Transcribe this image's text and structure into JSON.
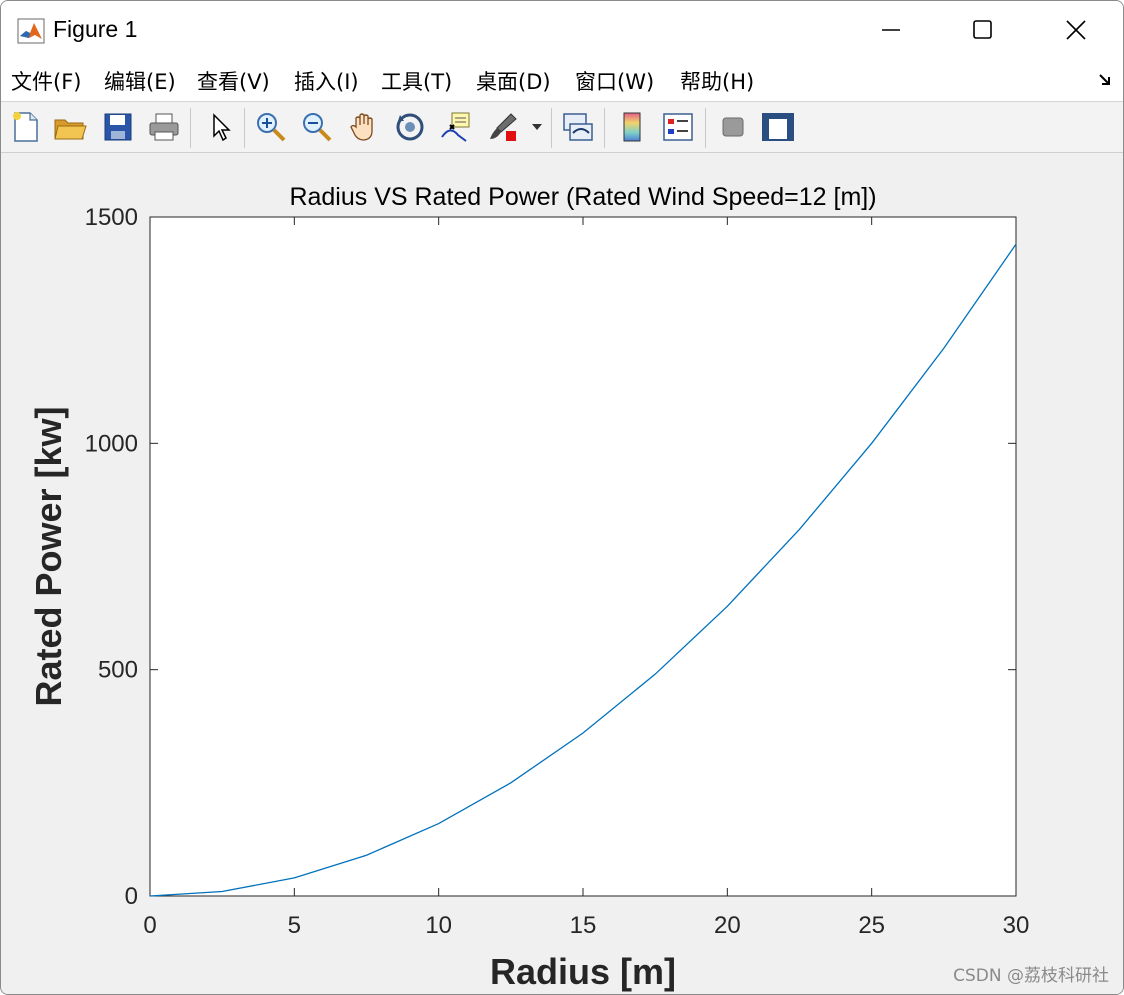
{
  "window": {
    "title": "Figure 1",
    "icons": [
      "matlab-logo-icon",
      "minimize-icon",
      "maximize-icon",
      "close-icon"
    ]
  },
  "menu": {
    "items": [
      "文件(F)",
      "编辑(E)",
      "查看(V)",
      "插入(I)",
      "工具(T)",
      "桌面(D)",
      "窗口(W)",
      "帮助(H)"
    ]
  },
  "toolbar": {
    "tools": [
      "new-figure-icon",
      "open-file-icon",
      "save-icon",
      "print-icon",
      "select-arrow-icon",
      "zoom-in-icon",
      "zoom-out-icon",
      "pan-hand-icon",
      "rotate-3d-icon",
      "data-cursor-icon",
      "brush-icon",
      "brush-dropdown-icon",
      "link-plot-icon",
      "colorbar-icon",
      "legend-icon",
      "hide-plot-tools-icon",
      "show-plot-tools-icon"
    ]
  },
  "chart_data": {
    "type": "line",
    "title": "Radius VS Rated Power (Rated Wind Speed=12 [m])",
    "xlabel": "Radius [m]",
    "ylabel": "Rated Power [kw]",
    "xlim": [
      0,
      30
    ],
    "ylim": [
      0,
      1500
    ],
    "xticks": [
      0,
      5,
      10,
      15,
      20,
      25,
      30
    ],
    "yticks": [
      0,
      500,
      1000,
      1500
    ],
    "grid": false,
    "series": [
      {
        "color": "#0072BD",
        "x": [
          0,
          2.5,
          5,
          7.5,
          10,
          12.5,
          15,
          17.5,
          20,
          22.5,
          25,
          27.5,
          30
        ],
        "y": [
          0,
          10,
          40,
          90,
          160,
          250,
          360,
          490,
          640,
          810,
          1000,
          1210,
          1440
        ]
      }
    ]
  },
  "watermark": "CSDN @荔枝科研社"
}
